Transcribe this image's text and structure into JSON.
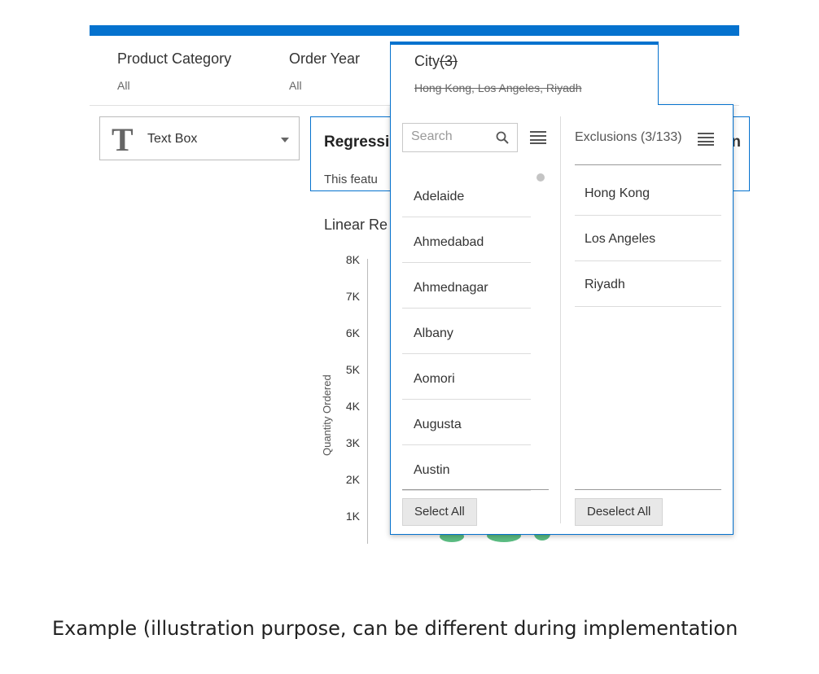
{
  "filters": {
    "product_category": {
      "label": "Product Category",
      "value": "All"
    },
    "order_year": {
      "label": "Order Year",
      "value": "All"
    },
    "city": {
      "label": "City",
      "count": "(3)",
      "value": "Hong Kong, Los Angeles, Riyadh"
    }
  },
  "visual_selector": {
    "label": "Text Box"
  },
  "regression_card": {
    "title": "Regressi",
    "description": "This featu",
    "right_heading": "n"
  },
  "chart": {
    "title": "Linear Re",
    "y_axis_label": "Quantity Ordered",
    "y_ticks": [
      "8K",
      "7K",
      "6K",
      "5K",
      "4K",
      "3K",
      "2K",
      "1K"
    ]
  },
  "city_popup": {
    "search_placeholder": "Search",
    "available": [
      "Adelaide",
      "Ahmedabad",
      "Ahmednagar",
      "Albany",
      "Aomori",
      "Augusta",
      "Austin"
    ],
    "exclusions_header": "Exclusions (3/133)",
    "exclusions": [
      "Hong Kong",
      "Los Angeles",
      "Riyadh"
    ],
    "select_all_label": "Select All",
    "deselect_all_label": "Deselect All"
  },
  "caption": "Example (illustration purpose, can be different during implementation",
  "colors": {
    "accent": "#0572ce",
    "scatter": "#5bbd83"
  }
}
